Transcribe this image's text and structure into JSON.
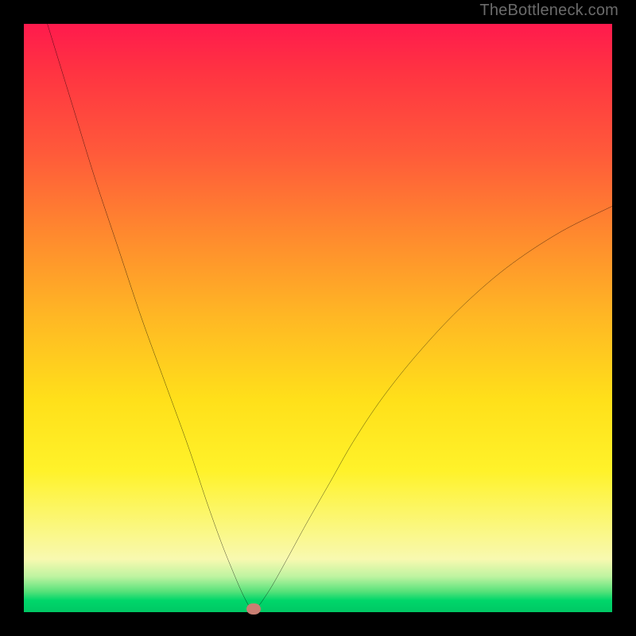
{
  "attribution": "TheBottleneck.com",
  "colors": {
    "frame": "#000000",
    "gradient_top": "#ff1a4d",
    "gradient_mid": "#ffe01a",
    "gradient_bottom": "#00c864",
    "curve": "#000000",
    "marker": "#c97e72"
  },
  "chart_data": {
    "type": "line",
    "title": "",
    "xlabel": "",
    "ylabel": "",
    "xlim": [
      0,
      100
    ],
    "ylim": [
      0,
      100
    ],
    "series": [
      {
        "name": "bottleneck-curve",
        "x": [
          4,
          8,
          12,
          16,
          20,
          24,
          28,
          31,
          33.5,
          35.5,
          37,
          38,
          38.6,
          39.2,
          40,
          41,
          42.5,
          45,
          48,
          52,
          56,
          61,
          67,
          74,
          82,
          91,
          100
        ],
        "y": [
          100,
          87,
          74,
          62,
          50,
          39,
          28,
          19,
          12,
          7,
          3.5,
          1.5,
          0.5,
          0.5,
          1.2,
          2.6,
          5,
          9.5,
          15,
          22,
          29,
          36.5,
          44,
          51.5,
          58.5,
          64.5,
          69
        ]
      }
    ],
    "marker": {
      "x": 39,
      "y": 0.5
    },
    "legend": false,
    "grid": false
  }
}
